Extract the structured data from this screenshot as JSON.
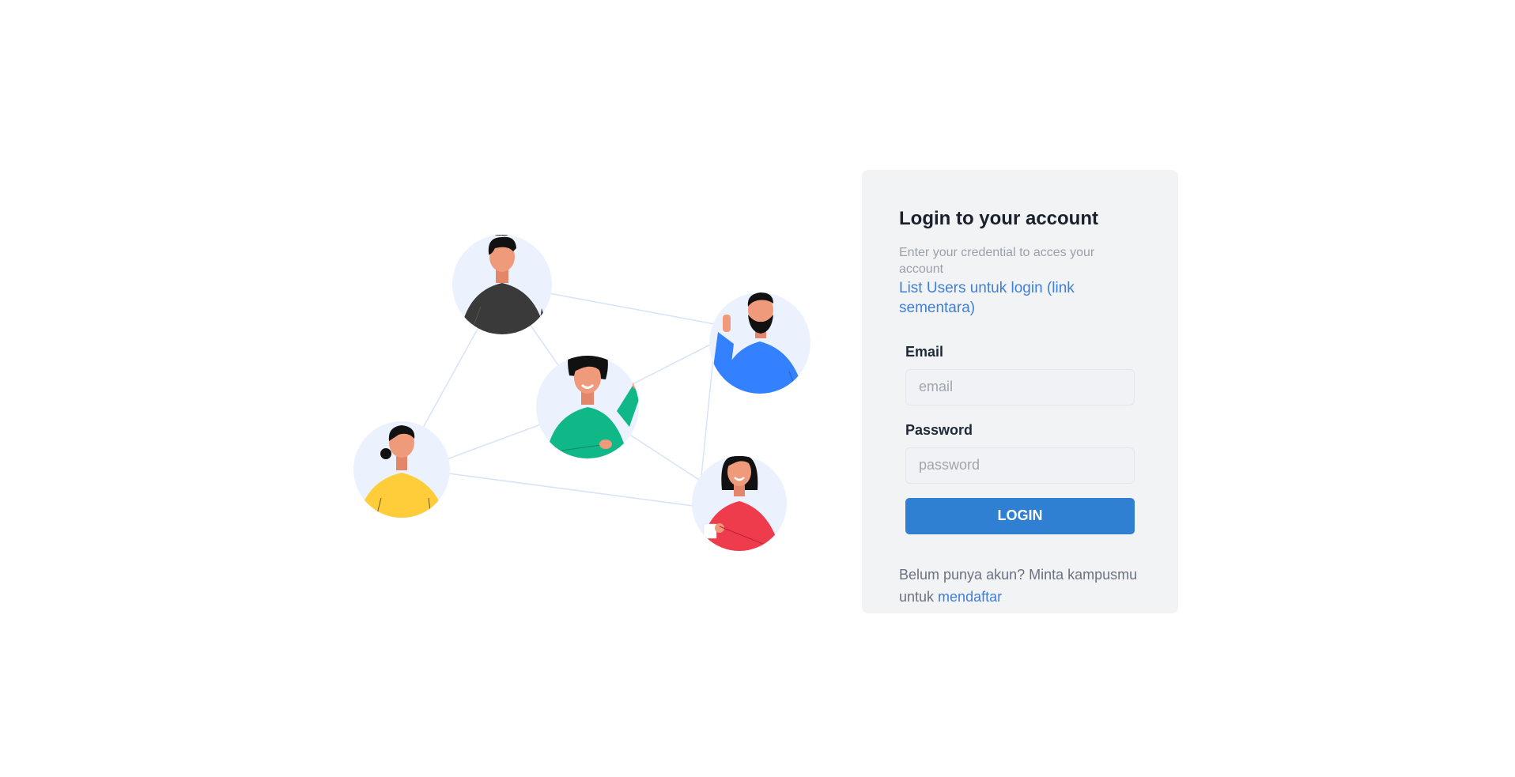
{
  "login_card": {
    "title": "Login to your account",
    "subtitle": "Enter your credential to acces your account",
    "users_link": "List Users untuk login (link sementara)",
    "email_label": "Email",
    "email_placeholder": "email",
    "email_value": "",
    "password_label": "Password",
    "password_placeholder": "password",
    "password_value": "",
    "login_button": "LOGIN",
    "footer_prefix": "Belum punya akun? Minta kampusmu untuk ",
    "signup_link": "mendaftar"
  },
  "colors": {
    "accent": "#2f80d2",
    "link": "#3f7fd9",
    "card_background": "#f2f3f5",
    "avatar_circle": "#ebf2fd"
  },
  "illustration": {
    "people": [
      {
        "shirt_color": "#3a3a3a",
        "name": "person-dark-shirt"
      },
      {
        "shirt_color": "#3381ff",
        "name": "person-blue-shirt"
      },
      {
        "shirt_color": "#11b887",
        "name": "person-green-shirt"
      },
      {
        "shirt_color": "#ffcd3a",
        "name": "person-yellow-shirt"
      },
      {
        "shirt_color": "#ee3c4d",
        "name": "person-red-shirt"
      }
    ]
  }
}
